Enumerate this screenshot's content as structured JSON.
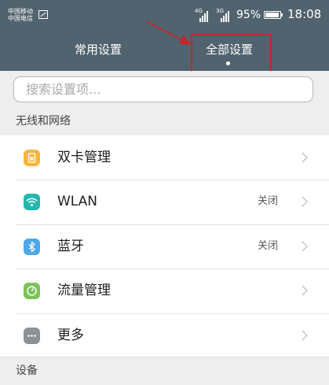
{
  "status_bar": {
    "carrier_1": "中国移动",
    "carrier_2": "中国电信",
    "net_1": "4G",
    "net_2": "3G",
    "battery_percent": "95%",
    "battery_level": 0.95,
    "time": "18:08"
  },
  "header": {
    "tabs": [
      {
        "label": "常用设置",
        "active": false
      },
      {
        "label": "全部设置",
        "active": true
      }
    ]
  },
  "annotation": {
    "highlight_color": "#c6242b"
  },
  "search": {
    "placeholder": "搜索设置项..."
  },
  "sections": {
    "network_title": "无线和网络",
    "device_title": "设备"
  },
  "rows": [
    {
      "label": "双卡管理",
      "value": "",
      "icon": "dual-sim-icon",
      "color": "#f5b73b"
    },
    {
      "label": "WLAN",
      "value": "关闭",
      "icon": "wifi-icon",
      "color": "#25b6ad"
    },
    {
      "label": "蓝牙",
      "value": "关闭",
      "icon": "bluetooth-icon",
      "color": "#4ea7e7"
    },
    {
      "label": "流量管理",
      "value": "",
      "icon": "data-usage-icon",
      "color": "#7cc35a"
    },
    {
      "label": "更多",
      "value": "",
      "icon": "more-icon",
      "color": "#8e9194"
    }
  ],
  "colors": {
    "header_bg": "#51636f",
    "section_bg": "#eeeeee"
  }
}
